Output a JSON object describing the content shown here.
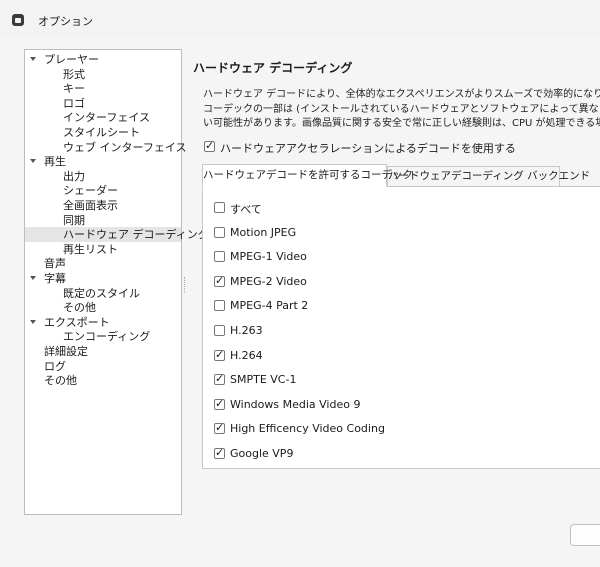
{
  "window": {
    "title": "オプション",
    "icon": "app-icon"
  },
  "tree": {
    "items": [
      {
        "label": "プレーヤー",
        "level": 0,
        "expanded": true
      },
      {
        "label": "形式",
        "level": 1
      },
      {
        "label": "キー",
        "level": 1
      },
      {
        "label": "ロゴ",
        "level": 1
      },
      {
        "label": "インターフェイス",
        "level": 1
      },
      {
        "label": "スタイルシート",
        "level": 1
      },
      {
        "label": "ウェブ インターフェイス",
        "level": 1
      },
      {
        "label": "再生",
        "level": 0,
        "expanded": true
      },
      {
        "label": "出力",
        "level": 1
      },
      {
        "label": "シェーダー",
        "level": 1
      },
      {
        "label": "全画面表示",
        "level": 1
      },
      {
        "label": "同期",
        "level": 1
      },
      {
        "label": "ハードウェア デコーディング",
        "level": 1,
        "selected": true
      },
      {
        "label": "再生リスト",
        "level": 1
      },
      {
        "label": "音声",
        "level": 0
      },
      {
        "label": "字幕",
        "level": 0,
        "expanded": true
      },
      {
        "label": "既定のスタイル",
        "level": 1
      },
      {
        "label": "その他",
        "level": 1
      },
      {
        "label": "エクスポート",
        "level": 0,
        "expanded": true
      },
      {
        "label": "エンコーディング",
        "level": 1
      },
      {
        "label": "詳細設定",
        "level": 0
      },
      {
        "label": "ログ",
        "level": 0
      },
      {
        "label": "その他",
        "level": 0
      }
    ]
  },
  "page": {
    "title": "ハードウェア デコーディング",
    "description": [
      "ハードウェア デコードにより、全体的なエクスペリエンスがよりスムーズで効率的になり、CPU の負荷",
      "コーデックの一部は (インストールされているハードウェアとソフトウェアによって異なりますが) 使用で",
      "い可能性があります。画像品質に関する安全で常に正しい経験則は、CPU が処理できる場合"
    ],
    "use_hw_accel": {
      "label": "ハードウェアアクセラレーションによるデコードを使用する",
      "checked": true
    }
  },
  "tabs": [
    {
      "label": "ハードウェアデコードを許可するコーデック",
      "active": true
    },
    {
      "label": "ハードウェアデコーディング バックエンド",
      "active": false
    }
  ],
  "codecs": [
    {
      "label": "すべて",
      "checked": false
    },
    {
      "label": "Motion JPEG",
      "checked": false
    },
    {
      "label": "MPEG-1 Video",
      "checked": false
    },
    {
      "label": "MPEG-2 Video",
      "checked": true
    },
    {
      "label": "MPEG-4 Part 2",
      "checked": false
    },
    {
      "label": "H.263",
      "checked": false
    },
    {
      "label": "H.264",
      "checked": true
    },
    {
      "label": "SMPTE VC-1",
      "checked": true
    },
    {
      "label": "Windows Media Video 9",
      "checked": true
    },
    {
      "label": "High Efficency Video Coding",
      "checked": true
    },
    {
      "label": "Google VP9",
      "checked": true
    }
  ],
  "footer": {
    "ok_label": ""
  }
}
